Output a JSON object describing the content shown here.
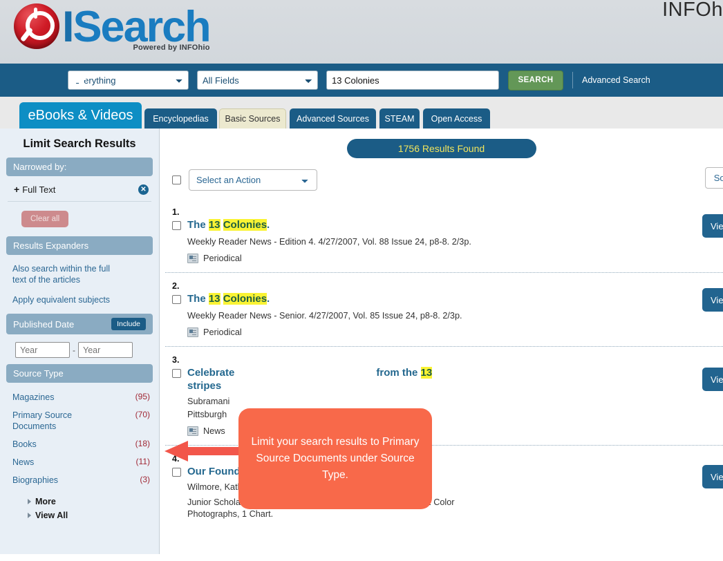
{
  "masthead": {
    "logo_i": "I",
    "logo_search": "Search",
    "logo_tagline": "Powered by INFOhio",
    "right_text": "INFOh",
    "logo_icon": "power-search-orb-icon"
  },
  "searchbar": {
    "home_icon": "home-icon",
    "scope_value": "Everything",
    "scope_options": [
      "Everything"
    ],
    "field_value": "All Fields",
    "field_options": [
      "All Fields"
    ],
    "query_value": "13 Colonies",
    "query_placeholder": "",
    "search_label": "SEARCH",
    "advanced_label": "Advanced Search"
  },
  "tabs": [
    {
      "label": "eBooks & Videos",
      "state": "primary"
    },
    {
      "label": "Encyclopedias",
      "state": "normal"
    },
    {
      "label": "Basic Sources",
      "state": "selected"
    },
    {
      "label": "Advanced Sources",
      "state": "normal"
    },
    {
      "label": "STEAM",
      "state": "normal"
    },
    {
      "label": "Open Access",
      "state": "normal"
    }
  ],
  "sidebar": {
    "title": "Limit Search Results",
    "narrowed_by": {
      "header": "Narrowed by:",
      "items": [
        {
          "plus": "+",
          "label": "Full Text",
          "remove_icon": "close-circle-icon"
        }
      ],
      "clear_all_label": "Clear all"
    },
    "results_expanders": {
      "header": "Results Expanders",
      "links": [
        "Also search within the full text of the articles",
        "Apply equivalent subjects"
      ]
    },
    "published_date": {
      "header": "Published Date",
      "include_label": "Include",
      "from_placeholder": "Year",
      "to_placeholder": "Year",
      "separator": "-"
    },
    "source_type": {
      "header": "Source Type",
      "facets": [
        {
          "label": "Magazines",
          "count": "(95)"
        },
        {
          "label": "Primary Source Documents",
          "count": "(70)"
        },
        {
          "label": "Books",
          "count": "(18)"
        },
        {
          "label": "News",
          "count": "(11)"
        },
        {
          "label": "Biographies",
          "count": "(3)"
        }
      ],
      "more_label": "More",
      "view_all_label": "View All"
    }
  },
  "results_header": {
    "badge": "1756 Results Found",
    "select_action_value": "Select an Action",
    "sort_by_label": "Sort By:"
  },
  "results": [
    {
      "num": "1.",
      "title_pre": "The ",
      "title_hl1": "13",
      "title_mid": " ",
      "title_hl2": "Colonies",
      "title_post": ".",
      "author": "",
      "meta": "Weekly Reader News - Edition 4. 4/27/2007, Vol. 88 Issue 24, p8-8. 2/3p.",
      "type_label": "Periodical",
      "type_icon": "periodical-icon",
      "view_label": "View"
    },
    {
      "num": "2.",
      "title_pre": "The ",
      "title_hl1": "13",
      "title_mid": " ",
      "title_hl2": "Colonies",
      "title_post": ".",
      "author": "",
      "meta": "Weekly Reader News - Senior. 4/27/2007, Vol. 85 Issue 24, p8-8. 2/3p.",
      "type_label": "Periodical",
      "type_icon": "periodical-icon",
      "view_label": "View"
    },
    {
      "num": "3.",
      "title_pre": "Celebrate",
      "title_hl1": "",
      "title_mid": "",
      "title_hl2": "",
      "title_post": "",
      "title_tail_pre": "from the ",
      "title_tail_hl": "13",
      "title_line2": "stripes",
      "author": "Subramani",
      "meta": "Pittsburgh",
      "type_label": "News",
      "type_icon": "news-icon",
      "view_label": "View"
    },
    {
      "num": "4.",
      "title_pre": "Our Founding Fathers.",
      "title_hl1": "",
      "title_mid": "",
      "title_hl2": "",
      "title_post": "",
      "author": "Wilmore, Kathy",
      "meta": "Junior Scholastic. 10/31/2005, Vol. 108 Issue 6, p16-448. 4p. 2 Color Photographs, 1 Chart.",
      "type_label": "",
      "type_icon": "",
      "view_label": "View"
    }
  ],
  "callout": {
    "text": "Limit your search results to Primary Source Documents under Source Type.",
    "arrow_icon": "left-arrow-annotation"
  },
  "colors": {
    "navy": "#1b5c86",
    "tab_primary": "#0d8ec4",
    "tab_selected": "#ece9cf",
    "green_button": "#639757",
    "sidebar_bg": "#e8eff6",
    "facet_header": "#8aabc2",
    "link_blue": "#2b6793",
    "count_red": "#a02734",
    "highlight_yellow": "#faf334",
    "badge_yellow_text": "#f2e55c",
    "callout_orange": "#f8694a",
    "clear_all_pink": "#cd8a8d"
  }
}
